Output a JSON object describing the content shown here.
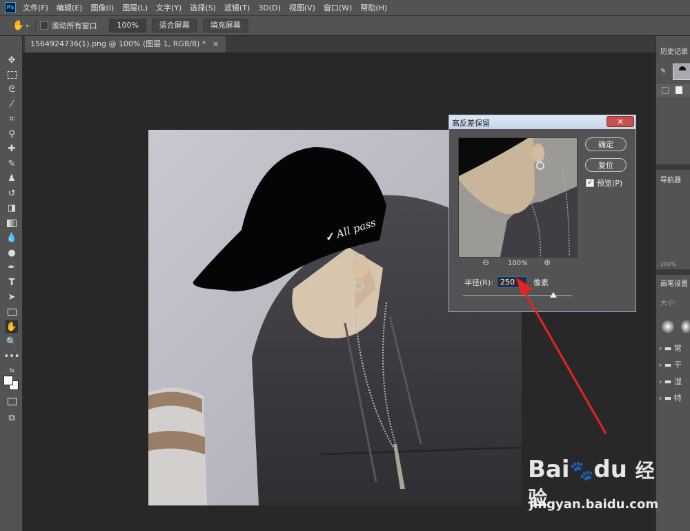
{
  "app": {
    "logo_text": "Ps"
  },
  "menu": [
    "文件(F)",
    "编辑(E)",
    "图像(I)",
    "图层(L)",
    "文字(Y)",
    "选择(S)",
    "滤镜(T)",
    "3D(D)",
    "视图(V)",
    "窗口(W)",
    "帮助(H)"
  ],
  "options": {
    "scroll_all_label": "滚动所有窗口",
    "zoom_value": "100%",
    "fit_screen_label": "适合屏幕",
    "fill_screen_label": "填充屏幕"
  },
  "document": {
    "tab_title": "1564924736(1).png @ 100% (图层 1, RGB/8) *",
    "tab_close": "×"
  },
  "tools": [
    "move-tool",
    "marquee-tool",
    "lasso-tool",
    "magic-wand-tool",
    "crop-tool",
    "eyedropper-tool",
    "healing-brush-tool",
    "brush-tool",
    "clone-stamp-tool",
    "history-brush-tool",
    "eraser-tool",
    "gradient-tool",
    "blur-tool",
    "dodge-tool",
    "pen-tool",
    "type-tool",
    "path-selection-tool",
    "rectangle-tool",
    "hand-tool",
    "zoom-tool",
    "more-tools"
  ],
  "panels": {
    "history_label": "历史记录",
    "navigator_label": "导航器",
    "nav_zoom": "100%",
    "brush_settings_label": "画笔设置",
    "size_label": "大小：",
    "folders": [
      "常",
      "干",
      "湿",
      "特"
    ]
  },
  "dialog": {
    "title": "高反差保留",
    "close_label": "✕",
    "ok_label": "确定",
    "reset_label": "复位",
    "preview_label": "预览(P)",
    "preview_checked": true,
    "zoom_value": "100%",
    "radius_label": "半径(R):",
    "radius_value": "250",
    "radius_unit": "像素",
    "slider_fraction": 0.83
  },
  "watermark": {
    "brand": "Bai",
    "brand_suffix": "du",
    "cn": "经验",
    "url": "jingyan.baidu.com"
  },
  "colors": {
    "arrow": "#e8231f",
    "dialog_border": "#9ab1cc",
    "close_button": "#c75050"
  }
}
